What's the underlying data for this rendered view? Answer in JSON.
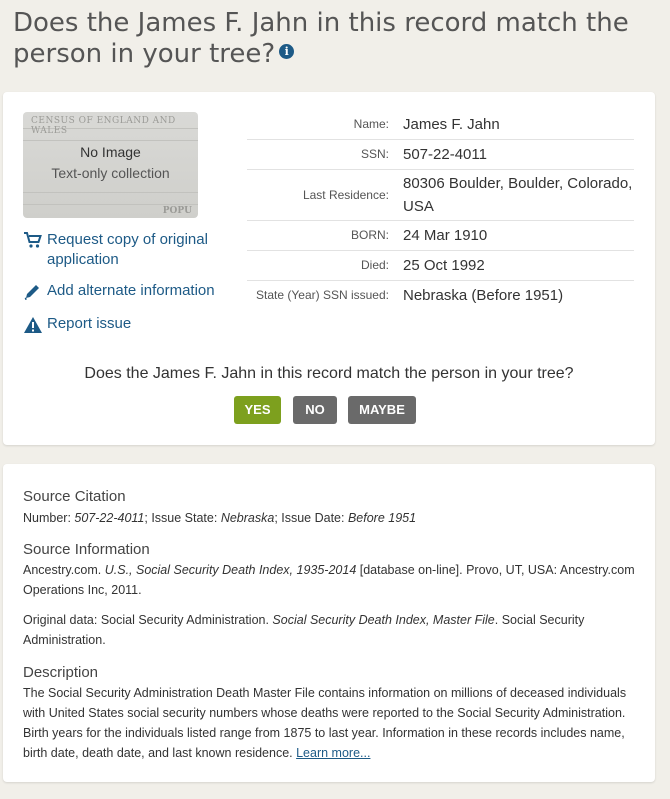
{
  "page": {
    "heading": "Does the James F. Jahn in this record match the person in your tree?",
    "info_icon": "i"
  },
  "thumbnail": {
    "no_image": "No Image",
    "text_only": "Text-only collection",
    "watermark_top": "CENSUS OF ENGLAND AND WALES",
    "watermark_bottom": "POPU"
  },
  "actions": {
    "request_copy": "Request copy of original application",
    "add_info": "Add alternate information",
    "report_issue": "Report issue"
  },
  "facts": [
    {
      "label": "Name:",
      "value": "James F. Jahn"
    },
    {
      "label": "SSN:",
      "value": "507-22-4011"
    },
    {
      "label": "Last Residence:",
      "value": "80306 Boulder, Boulder, Colorado, USA"
    },
    {
      "label": "BORN:",
      "value": "24 Mar 1910"
    },
    {
      "label": "Died:",
      "value": "25 Oct 1992"
    },
    {
      "label": "State (Year) SSN issued:",
      "value": "Nebraska (Before 1951)"
    }
  ],
  "match": {
    "question": "Does the James F. Jahn in this record match the person in your tree?",
    "yes": "YES",
    "no": "NO",
    "maybe": "MAYBE"
  },
  "source": {
    "citation_title": "Source Citation",
    "citation_number_label": "Number: ",
    "citation_number": "507-22-4011",
    "citation_state_label": "; Issue State: ",
    "citation_state": "Nebraska",
    "citation_date_label": "; Issue Date: ",
    "citation_date": "Before 1951",
    "info_title": "Source Information",
    "info_prefix": "Ancestry.com. ",
    "info_italic": "U.S., Social Security Death Index, 1935-2014",
    "info_suffix": " [database on-line]. Provo, UT, USA: Ancestry.com Operations Inc, 2011.",
    "orig_prefix": "Original data: Social Security Administration. ",
    "orig_italic": "Social Security Death Index, Master File",
    "orig_suffix": ". Social Security Administration.",
    "desc_title": "Description",
    "desc_text": "The Social Security Administration Death Master File contains information on millions of deceased individuals with United States social security numbers whose deaths were reported to the Social Security Administration. Birth years for the individuals listed range from 1875 to last year. Information in these records includes name, birth date, death date, and last known residence. ",
    "learn_more": "Learn more..."
  }
}
